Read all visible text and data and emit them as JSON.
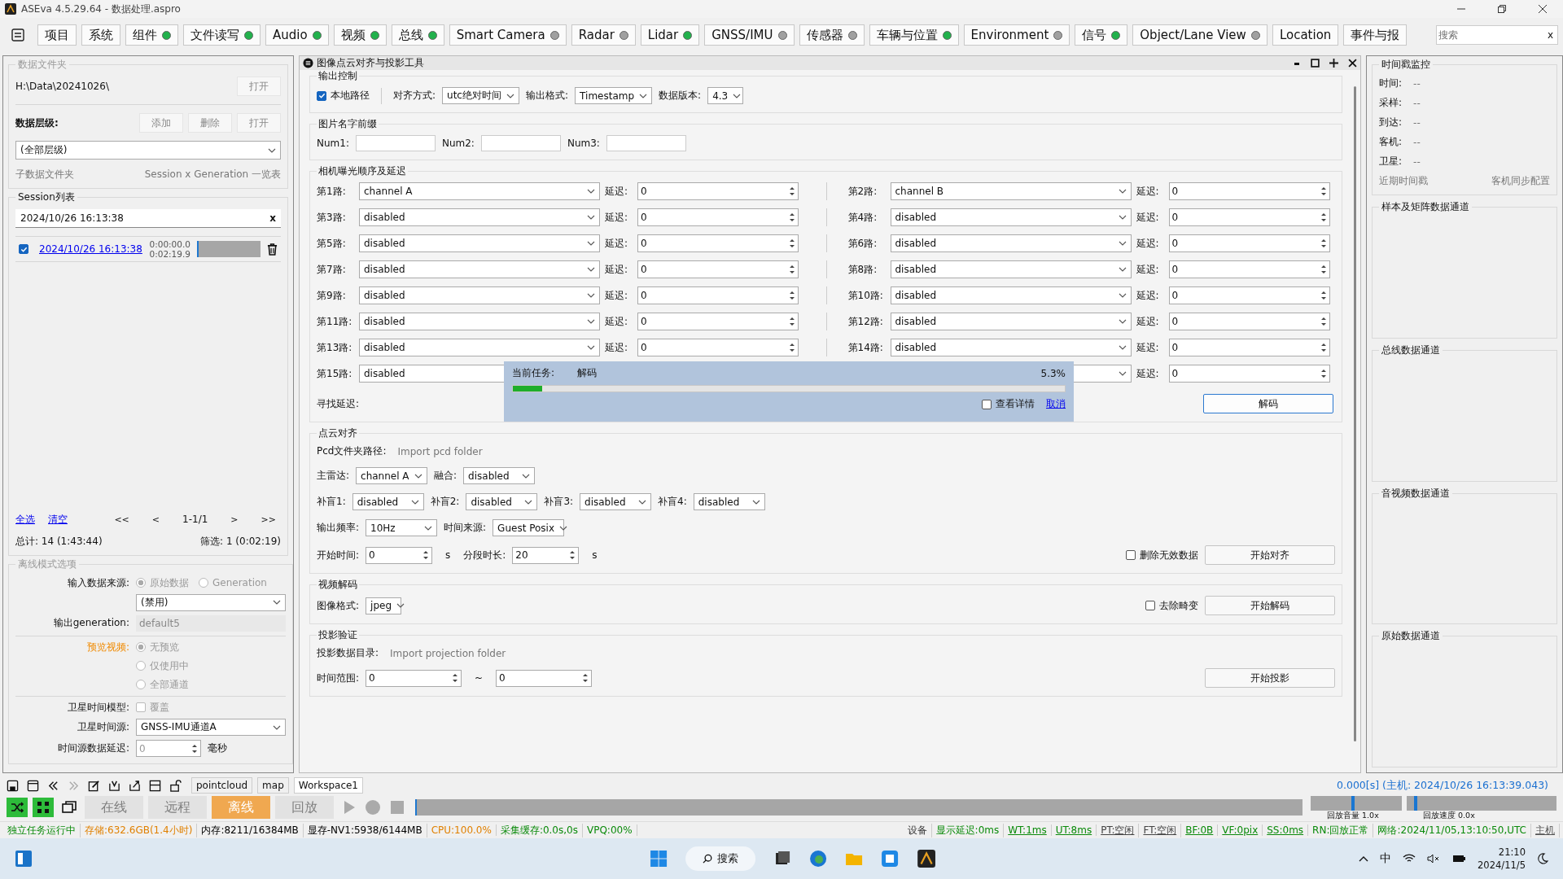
{
  "window": {
    "title": "ASEva 4.5.29.64 - 数据处理.aspro"
  },
  "menu": [
    {
      "label": "项目"
    },
    {
      "label": "系统"
    },
    {
      "label": "组件",
      "color": "#22b14c"
    },
    {
      "label": "文件读写",
      "color": "#22b14c"
    },
    {
      "label": "Audio",
      "color": "#22b14c"
    },
    {
      "label": "视频",
      "color": "#22b14c"
    },
    {
      "label": "总线",
      "color": "#22b14c"
    },
    {
      "label": "Smart Camera",
      "color": "#a0a0a0"
    },
    {
      "label": "Radar",
      "color": "#a0a0a0"
    },
    {
      "label": "Lidar",
      "color": "#22b14c"
    },
    {
      "label": "GNSS/IMU",
      "color": "#a0a0a0"
    },
    {
      "label": "传感器",
      "color": "#a0a0a0"
    },
    {
      "label": "车辆与位置",
      "color": "#22b14c"
    },
    {
      "label": "Environment",
      "color": "#a0a0a0"
    },
    {
      "label": "信号",
      "color": "#22b14c"
    },
    {
      "label": "Object/Lane View",
      "color": "#a0a0a0"
    },
    {
      "label": "Location"
    },
    {
      "label": "事件与报"
    }
  ],
  "search": {
    "placeholder": "搜索",
    "clear": "x"
  },
  "left": {
    "folder": {
      "title": "数据文件夹",
      "path": "H:\\Data\\20241026\\",
      "open": "打开",
      "level_label": "数据层级:",
      "buttons": [
        "添加",
        "删除",
        "打开"
      ],
      "level_select": "(全部层级)",
      "subfolder": "子数据文件夹",
      "overview": "Session x Generation 一览表"
    },
    "sessions": {
      "title": "Session列表",
      "filter": "2024/10/26 16:13:38",
      "clear": "x",
      "items": [
        {
          "checked": true,
          "name": "2024/10/26 16:13:38",
          "start": "0:00:00.0",
          "end": "0:02:19.9"
        }
      ],
      "select_all": "全选",
      "clear_all": "清空",
      "pager": [
        "<<",
        "<",
        "1-1/1",
        ">",
        ">>"
      ],
      "total": "总计: 14 (1:43:44)",
      "filtered": "筛选: 1 (0:02:19)"
    },
    "offline": {
      "title": "离线模式选项",
      "source_label": "输入数据来源:",
      "sources": [
        {
          "label": "原始数据",
          "selected": true
        },
        {
          "label": "Generation",
          "selected": false
        }
      ],
      "generation_select": "(禁用)",
      "output_label": "输出generation:",
      "output_value": "default5",
      "preview_label": "预览视频:",
      "previews": [
        {
          "label": "无预览",
          "selected": true
        },
        {
          "label": "仅使用中",
          "selected": false
        },
        {
          "label": "全部通道",
          "selected": false
        }
      ],
      "sat_model_label": "卫星时间模型:",
      "override": {
        "label": "覆盖",
        "checked": false
      },
      "sat_source_label": "卫星时间源:",
      "sat_source": "GNSS-IMU通道A",
      "delay_label": "时间源数据延迟:",
      "delay": "0",
      "delay_unit": "毫秒"
    }
  },
  "tool": {
    "title": "图像点云对齐与投影工具",
    "output": {
      "title": "输出控制",
      "local_path": {
        "label": "本地路径",
        "checked": true
      },
      "fields": [
        {
          "label": "对齐方式:",
          "value": "utc绝对时间"
        },
        {
          "label": "输出格式:",
          "value": "Timestamp"
        },
        {
          "label": "数据版本:",
          "value": "4.3"
        }
      ]
    },
    "prefix": {
      "title": "图片名字前缀",
      "fields": [
        {
          "label": "Num1:"
        },
        {
          "label": "Num2:"
        },
        {
          "label": "Num3:"
        }
      ]
    },
    "camera": {
      "title": "相机曝光顺序及延迟",
      "channels": [
        {
          "label": "第1路:",
          "value": "channel A",
          "delay_label": "延迟:",
          "delay": "0"
        },
        {
          "label": "第2路:",
          "value": "channel B",
          "delay_label": "延迟:",
          "delay": "0"
        },
        {
          "label": "第3路:",
          "value": "disabled",
          "delay_label": "延迟:",
          "delay": "0"
        },
        {
          "label": "第4路:",
          "value": "disabled",
          "delay_label": "延迟:",
          "delay": "0"
        },
        {
          "label": "第5路:",
          "value": "disabled",
          "delay_label": "延迟:",
          "delay": "0"
        },
        {
          "label": "第6路:",
          "value": "disabled",
          "delay_label": "延迟:",
          "delay": "0"
        },
        {
          "label": "第7路:",
          "value": "disabled",
          "delay_label": "延迟:",
          "delay": "0"
        },
        {
          "label": "第8路:",
          "value": "disabled",
          "delay_label": "延迟:",
          "delay": "0"
        },
        {
          "label": "第9路:",
          "value": "disabled",
          "delay_label": "延迟:",
          "delay": "0"
        },
        {
          "label": "第10路:",
          "value": "disabled",
          "delay_label": "延迟:",
          "delay": "0"
        },
        {
          "label": "第11路:",
          "value": "disabled",
          "delay_label": "延迟:",
          "delay": "0"
        },
        {
          "label": "第12路:",
          "value": "disabled",
          "delay_label": "延迟:",
          "delay": "0"
        },
        {
          "label": "第13路:",
          "value": "disabled",
          "delay_label": "延迟:",
          "delay": "0"
        },
        {
          "label": "第14路:",
          "value": "disabled",
          "delay_label": "延迟:",
          "delay": "0"
        },
        {
          "label": "第15路:",
          "value": "disabled"
        },
        {
          "delay_label": "延迟:",
          "delay": "0"
        }
      ],
      "find_delay": "寻找延迟:",
      "decode": "解码"
    },
    "progress": {
      "task_label": "当前任务:",
      "task": "解码",
      "percent": "5.3%",
      "level": 0.053,
      "details": {
        "label": "查看详情",
        "checked": false
      },
      "cancel": "取消"
    },
    "pointcloud": {
      "title": "点云对齐",
      "pcd_label": "Pcd文件夹路径:",
      "pcd_placeholder": "Import pcd folder",
      "rows": [
        [
          {
            "label": "主雷达:",
            "value": "channel A"
          },
          {
            "label": "融合:",
            "value": "disabled"
          }
        ],
        [
          {
            "label": "补盲1:",
            "value": "disabled"
          },
          {
            "label": "补盲2:",
            "value": "disabled"
          },
          {
            "label": "补盲3:",
            "value": "disabled"
          },
          {
            "label": "补盲4:",
            "value": "disabled"
          }
        ],
        [
          {
            "label": "输出频率:",
            "value": "10Hz"
          },
          {
            "label": "时间来源:",
            "value": "Guest Posix"
          }
        ]
      ],
      "start_label": "开始时间:",
      "start": "0",
      "start_unit": "s",
      "segment_label": "分段时长:",
      "segment": "20",
      "segment_unit": "s",
      "remove_invalid": {
        "label": "删除无效数据",
        "checked": false
      },
      "button": "开始对齐"
    },
    "video": {
      "title": "视频解码",
      "format_label": "图像格式:",
      "format": "jpeg",
      "undistort": {
        "label": "去除畸变",
        "checked": false
      },
      "button": "开始解码"
    },
    "projection": {
      "title": "投影验证",
      "dir_label": "投影数据目录:",
      "dir_placeholder": "Import projection folder",
      "range_label": "时间范围:",
      "from": "0",
      "to_sep": "~",
      "to": "0",
      "button": "开始投影"
    }
  },
  "right": {
    "monitor": {
      "title": "时间戳监控",
      "rows": [
        {
          "label": "时间:",
          "value": "--"
        },
        {
          "label": "采样:",
          "value": "--"
        },
        {
          "label": "到达:",
          "value": "--"
        },
        {
          "label": "客机:",
          "value": "--"
        },
        {
          "label": "卫星:",
          "value": "--"
        }
      ],
      "recent": "近期时间戳",
      "sync": "客机同步配置"
    },
    "groups": [
      "样本及矩阵数据通道",
      "总线数据通道",
      "音视频数据通道",
      "原始数据通道"
    ]
  },
  "workspace_tabs": [
    {
      "label": "pointcloud",
      "selected": false
    },
    {
      "label": "map",
      "selected": false
    },
    {
      "label": "Workspace1",
      "selected": true
    }
  ],
  "timestamp": "0.000[s] (主机: 2024/10/26 16:13:39.043)",
  "modes": [
    {
      "label": "在线",
      "selected": false
    },
    {
      "label": "远程",
      "selected": false
    },
    {
      "label": "离线",
      "selected": true
    },
    {
      "label": "回放",
      "selected": false
    }
  ],
  "volume": {
    "label": "回放音量 1.0x",
    "level": 0.45
  },
  "speed": {
    "label": "回放速度 0.0x",
    "level": 0.05
  },
  "status_left": [
    {
      "text": "独立任务运行中",
      "color": "#0a8a0a",
      "underline": false
    },
    {
      "text": "存储:632.6GB(1.4小时)",
      "color": "#e08000",
      "underline": false
    },
    {
      "text": "内存:8211/16384MB",
      "color": "#000000",
      "underline": false
    },
    {
      "text": "显存-NV1:5938/6144MB",
      "color": "#000000",
      "underline": false
    },
    {
      "text": "CPU:100.0%",
      "color": "#e08000",
      "underline": false
    },
    {
      "text": "采集缓存:0.0s,0s",
      "color": "#0a8a0a",
      "underline": false
    },
    {
      "text": "VPQ:00%",
      "color": "#0a8a0a",
      "underline": false
    }
  ],
  "status_right": [
    {
      "text": "设备",
      "color": "#333333",
      "underline": false
    },
    {
      "text": "显示延迟:0ms",
      "color": "#0a8a0a",
      "underline": false
    },
    {
      "text": "WT:1ms",
      "color": "#0a8a0a",
      "underline": true
    },
    {
      "text": "UT:8ms",
      "color": "#0a8a0a",
      "underline": true
    },
    {
      "text": "PT:空闲",
      "color": "#444444",
      "underline": true
    },
    {
      "text": "FT:空闲",
      "color": "#444444",
      "underline": true
    },
    {
      "text": "BF:0B",
      "color": "#0a8a0a",
      "underline": true
    },
    {
      "text": "VF:0pix",
      "color": "#0a8a0a",
      "underline": true
    },
    {
      "text": "SS:0ms",
      "color": "#0a8a0a",
      "underline": true
    },
    {
      "text": "RN:回放正常",
      "color": "#0a8a0a",
      "underline": false
    },
    {
      "text": "网络:2024/11/05,13:10:50,UTC",
      "color": "#0a8a0a",
      "underline": false
    },
    {
      "text": "主机",
      "color": "#555555",
      "underline": true
    }
  ],
  "taskbar": {
    "search": "搜索",
    "ime": "中",
    "time": "21:10",
    "date": "2024/11/5"
  }
}
